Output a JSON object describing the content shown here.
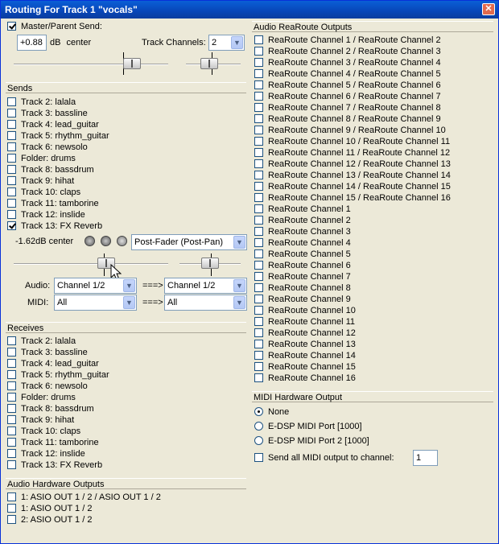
{
  "window": {
    "title": "Routing For Track 1 \"vocals\"",
    "close_label": "✕"
  },
  "master": {
    "label": "Master/Parent Send:",
    "checked": true,
    "volume": "+0.88",
    "unit": "dB",
    "pan": "center",
    "track_channels_label": "Track Channels:",
    "track_channels": "2"
  },
  "sends": {
    "header": "Sends",
    "items": [
      "Track 2: lalala",
      "Track 3: bassline",
      "Track 4: lead_guitar",
      "Track 5: rhythm_guitar",
      "Track 6: newsolo",
      "Folder: drums",
      "Track 8: bassdrum",
      "Track 9: hihat",
      "Track 10: claps",
      "Track 11: tamborine",
      "Track 12: inslide",
      "Track 13: FX Reverb"
    ],
    "checked_index": 11,
    "send_volume": "-1.62dB center",
    "mode": "Post-Fader (Post-Pan)",
    "audio_label": "Audio:",
    "audio_src": "Channel 1/2",
    "arrow": "===>",
    "audio_dst": "Channel 1/2",
    "midi_label": "MIDI:",
    "midi_src": "All",
    "midi_dst": "All",
    "icons": [
      "mute-icon",
      "phase-icon",
      "mono-stereo-icon"
    ]
  },
  "receives": {
    "header": "Receives",
    "items": [
      "Track 2: lalala",
      "Track 3: bassline",
      "Track 4: lead_guitar",
      "Track 5: rhythm_guitar",
      "Track 6: newsolo",
      "Folder: drums",
      "Track 8: bassdrum",
      "Track 9: hihat",
      "Track 10: claps",
      "Track 11: tamborine",
      "Track 12: inslide",
      "Track 13: FX Reverb"
    ]
  },
  "hw_outputs": {
    "header": "Audio Hardware Outputs",
    "items": [
      "1: ASIO OUT 1 / 2 / ASIO OUT 1 / 2",
      "1: ASIO OUT 1 / 2",
      "2: ASIO OUT 1 / 2"
    ]
  },
  "rearoute": {
    "header": "Audio ReaRoute Outputs",
    "items": [
      "ReaRoute Channel 1 / ReaRoute Channel 2",
      "ReaRoute Channel 2 / ReaRoute Channel 3",
      "ReaRoute Channel 3 / ReaRoute Channel 4",
      "ReaRoute Channel 4 / ReaRoute Channel 5",
      "ReaRoute Channel 5 / ReaRoute Channel 6",
      "ReaRoute Channel 6 / ReaRoute Channel 7",
      "ReaRoute Channel 7 / ReaRoute Channel 8",
      "ReaRoute Channel 8 / ReaRoute Channel 9",
      "ReaRoute Channel 9 / ReaRoute Channel 10",
      "ReaRoute Channel 10 / ReaRoute Channel 11",
      "ReaRoute Channel 11 / ReaRoute Channel 12",
      "ReaRoute Channel 12 / ReaRoute Channel 13",
      "ReaRoute Channel 13 / ReaRoute Channel 14",
      "ReaRoute Channel 14 / ReaRoute Channel 15",
      "ReaRoute Channel 15 / ReaRoute Channel 16",
      "ReaRoute Channel 1",
      "ReaRoute Channel 2",
      "ReaRoute Channel 3",
      "ReaRoute Channel 4",
      "ReaRoute Channel 5",
      "ReaRoute Channel 6",
      "ReaRoute Channel 7",
      "ReaRoute Channel 8",
      "ReaRoute Channel 9",
      "ReaRoute Channel 10",
      "ReaRoute Channel 11",
      "ReaRoute Channel 12",
      "ReaRoute Channel 13",
      "ReaRoute Channel 14",
      "ReaRoute Channel 15",
      "ReaRoute Channel 16"
    ]
  },
  "midi_hw": {
    "header": "MIDI Hardware Output",
    "options": [
      "None",
      "E-DSP MIDI Port [1000]",
      "E-DSP MIDI Port 2 [1000]"
    ],
    "selected_index": 0,
    "send_all_label": "Send all MIDI output to channel:",
    "send_all_channel": "1"
  }
}
